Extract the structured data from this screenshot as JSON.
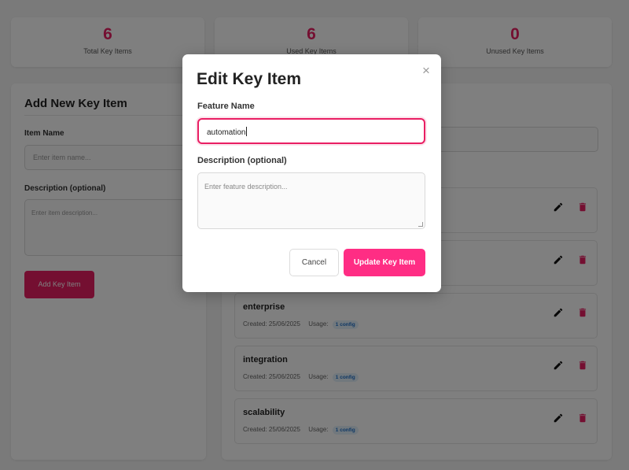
{
  "stats": [
    {
      "value": "6",
      "label": "Total Key Items"
    },
    {
      "value": "6",
      "label": "Used Key Items"
    },
    {
      "value": "0",
      "label": "Unused Key Items"
    }
  ],
  "add_form": {
    "title": "Add New Key Item",
    "name_label": "Item Name",
    "name_placeholder": "Enter item name...",
    "desc_label": "Description (optional)",
    "desc_placeholder": "Enter item description...",
    "submit_label": "Add Key Item"
  },
  "items": [
    {
      "name": "",
      "created": "",
      "usage_label": "",
      "usage": ""
    },
    {
      "name": "",
      "created": "",
      "usage_label": "",
      "usage": ""
    },
    {
      "name": "enterprise",
      "created": "Created: 25/06/2025",
      "usage_label": "Usage:",
      "usage": "1 config"
    },
    {
      "name": "integration",
      "created": "Created: 25/06/2025",
      "usage_label": "Usage:",
      "usage": "1 config"
    },
    {
      "name": "scalability",
      "created": "Created: 25/06/2025",
      "usage_label": "Usage:",
      "usage": "1 config"
    }
  ],
  "modal": {
    "title": "Edit Key Item",
    "close_symbol": "×",
    "name_label": "Feature Name",
    "name_value": "automation",
    "desc_label": "Description (optional)",
    "desc_placeholder": "Enter feature description...",
    "cancel_label": "Cancel",
    "update_label": "Update Key Item"
  },
  "colors": {
    "accent": "#e91e63",
    "update_button": "#ff2d84",
    "badge_bg": "#e3f0fb",
    "badge_text": "#1e6fc8"
  },
  "icons": {
    "edit": "pencil-icon",
    "delete": "trash-icon",
    "close": "close-icon"
  }
}
